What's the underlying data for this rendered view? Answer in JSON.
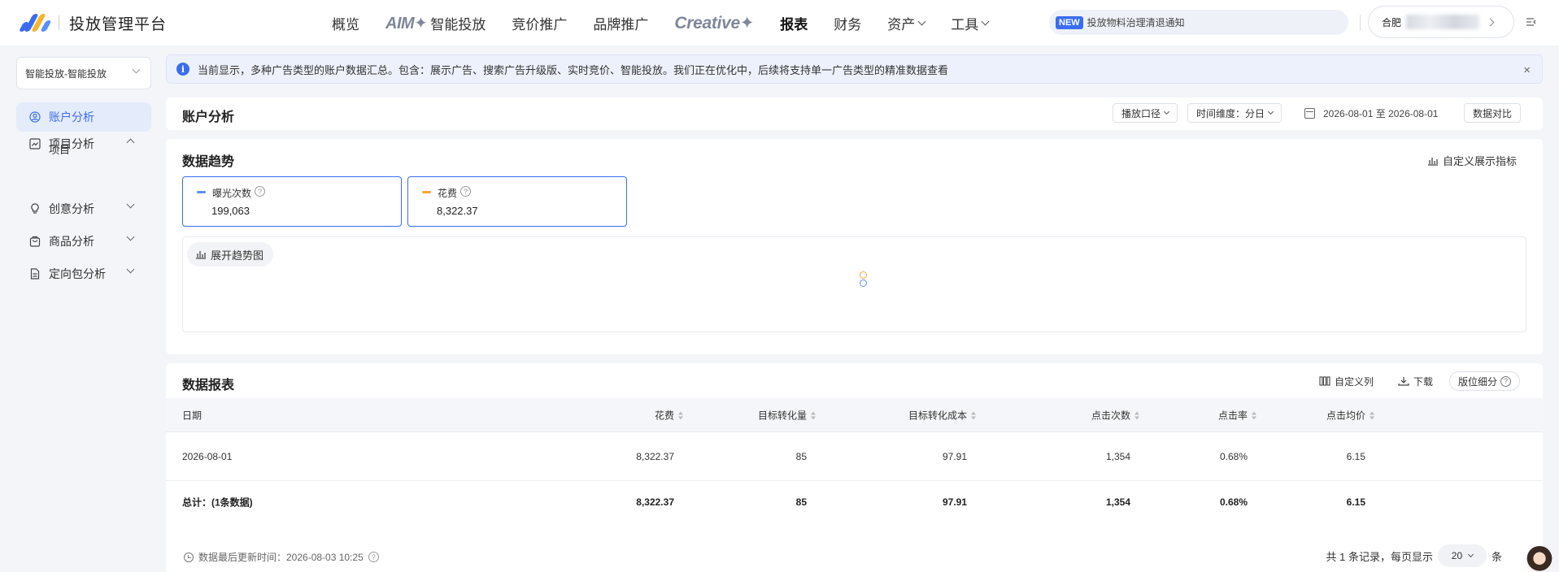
{
  "topnav": {
    "title": "投放管理平台",
    "items": [
      {
        "label": "概览"
      },
      {
        "label_brand": "AIM✦",
        "label": "智能投放"
      },
      {
        "label": "竞价推广"
      },
      {
        "label": "品牌推广"
      },
      {
        "label_brand": "Creative✦"
      },
      {
        "label": "报表",
        "active": true
      },
      {
        "label": "财务"
      },
      {
        "label": "资产"
      },
      {
        "label": "工具"
      }
    ],
    "notice_tag": "NEW",
    "notice_text": "投放物料治理清退通知",
    "account_prefix": "合肥"
  },
  "sidebar": {
    "select_value": "智能投放-智能投放",
    "items": [
      {
        "label": "账户分析",
        "active": true
      },
      {
        "label": "项目分析"
      },
      {
        "label": "项目"
      },
      {
        "label": "创意分析"
      },
      {
        "label": "商品分析"
      },
      {
        "label": "定向包分析"
      }
    ]
  },
  "info_bar": {
    "text": "当前显示，多种广告类型的账户数据汇总。包含：展示广告、搜索广告升级版、实时竞价、智能投放。我们正在优化中，后续将支持单一广告类型的精准数据查看",
    "close": "×"
  },
  "account_analysis": {
    "title": "账户分析",
    "caliber_label": "播放口径",
    "time_dimension_label": "时间维度：分日",
    "date_range": "2026-08-01 至 2026-08-01",
    "compare_label": "数据对比"
  },
  "trend": {
    "title": "数据趋势",
    "custom_metric_label": "自定义展示指标",
    "metrics": [
      {
        "label": "曝光次数",
        "value": "199,063",
        "color": "#5b8ff9"
      },
      {
        "label": "花费",
        "value": "8,322.37",
        "color": "#f6a53b"
      }
    ],
    "expand_label": "展开趋势图"
  },
  "report": {
    "title": "数据报表",
    "custom_columns_label": "自定义列",
    "download_label": "下载",
    "position_breakdown_label": "版位细分",
    "columns": [
      "日期",
      "花费",
      "目标转化量",
      "目标转化成本",
      "点击次数",
      "点击率",
      "点击均价"
    ],
    "rows": [
      [
        "2026-08-01",
        "8,322.37",
        "85",
        "97.91",
        "1,354",
        "0.68%",
        "6.15"
      ]
    ],
    "total": [
      "总计：(1条数据)",
      "8,322.37",
      "85",
      "97.91",
      "1,354",
      "0.68%",
      "6.15"
    ]
  },
  "footer": {
    "updated_text": "数据最后更新时间：2026-08-03 10:25",
    "total_records": "共 1 条记录，每页显示",
    "page_size": "20",
    "unit": "条"
  }
}
